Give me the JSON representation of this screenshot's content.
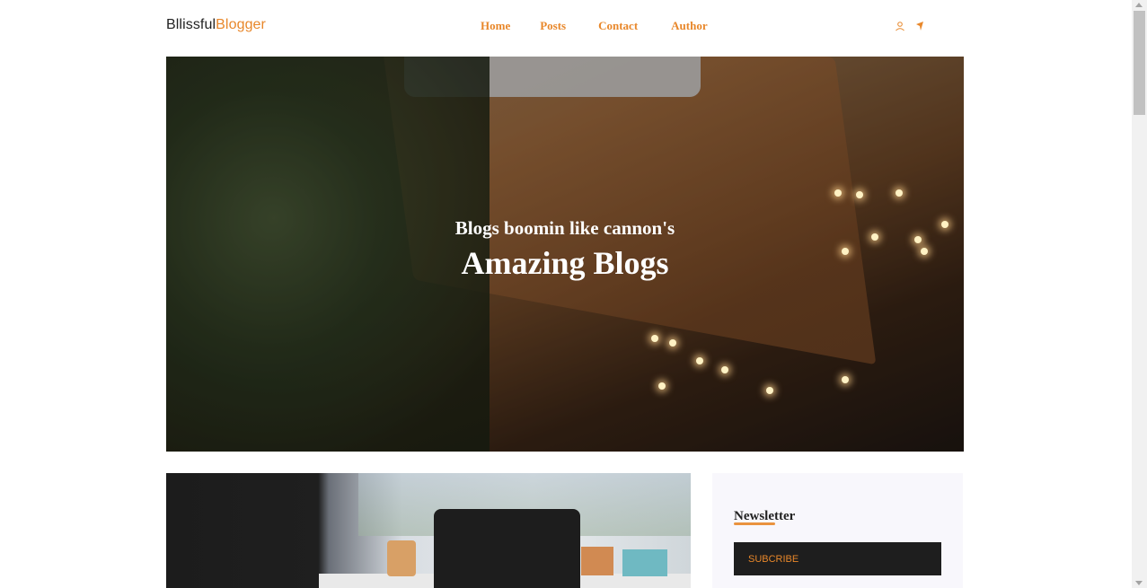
{
  "brand": {
    "part1": "Bllissful",
    "part2": "Blogger",
    "accent_color": "#e8872a"
  },
  "nav": {
    "items": [
      {
        "label": "Home"
      },
      {
        "label": "Posts"
      },
      {
        "label": "Contact"
      },
      {
        "label": "Author"
      }
    ]
  },
  "header_icons": [
    "user-icon",
    "send-icon"
  ],
  "hero": {
    "subtitle": "Blogs boomin like cannon's",
    "title": "Amazing Blogs"
  },
  "sidebar": {
    "newsletter_title": "Newsletter",
    "subscribe_label": "SUBCRIBE"
  }
}
